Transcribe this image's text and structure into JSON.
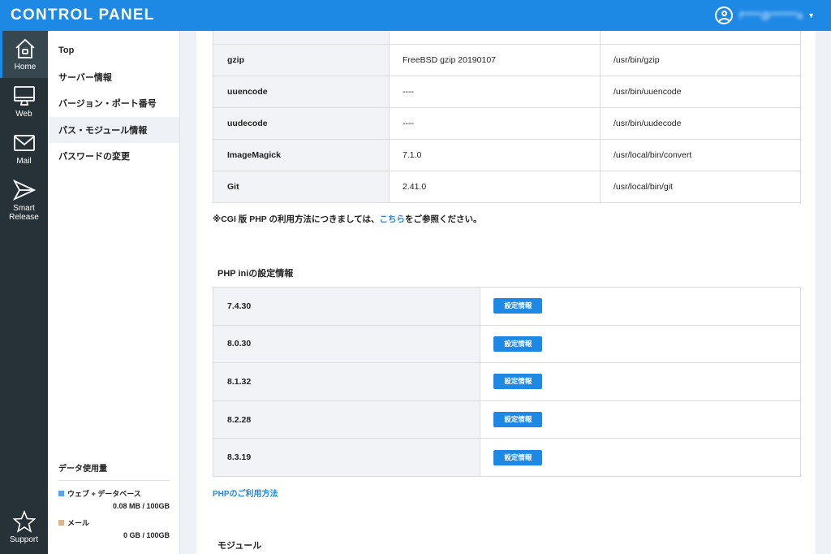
{
  "header": {
    "brand": "CONTROL PANEL",
    "username": "f*****@*******a",
    "caret": "▼",
    "accent": "#1e88e5"
  },
  "iconbar": {
    "home": "Home",
    "web": "Web",
    "mail": "Mail",
    "smart_release": "Smart Release",
    "support": "Support"
  },
  "subnav": {
    "items": [
      {
        "label": "Top"
      },
      {
        "label": "サーバー情報"
      },
      {
        "label": "バージョン・ポート番号"
      },
      {
        "label": "パス・モジュール情報"
      },
      {
        "label": "パスワードの変更"
      }
    ],
    "usage": {
      "title": "データ使用量",
      "web_label": "ウェブ + データベース",
      "web_value": "0.08 MB / 100GB",
      "web_color": "#5ba4e5",
      "mail_label": "メール",
      "mail_value": "0 GB / 100GB",
      "mail_color": "#d9b48f"
    }
  },
  "paths": {
    "rows": [
      {
        "name": "",
        "version": "",
        "path": ""
      },
      {
        "name": "gzip",
        "version": "FreeBSD gzip 20190107",
        "path": "/usr/bin/gzip"
      },
      {
        "name": "uuencode",
        "version": "----",
        "path": "/usr/bin/uuencode"
      },
      {
        "name": "uudecode",
        "version": "----",
        "path": "/usr/bin/uudecode"
      },
      {
        "name": "ImageMagick",
        "version": "7.1.0",
        "path": "/usr/local/bin/convert"
      },
      {
        "name": "Git",
        "version": "2.41.0",
        "path": "/usr/local/bin/git"
      }
    ],
    "note_before": "※CGI 版 PHP の利用方法につきましては、",
    "note_link": "こちら",
    "note_after": "をご参照ください。"
  },
  "php_ini": {
    "title": "PHP iniの設定情報",
    "button_label": "設定情報",
    "versions": [
      "7.4.30",
      "8.0.30",
      "8.1.32",
      "8.2.28",
      "8.3.19"
    ],
    "usage_link": "PHPのご利用方法"
  },
  "modules": {
    "title": "モジュール"
  }
}
